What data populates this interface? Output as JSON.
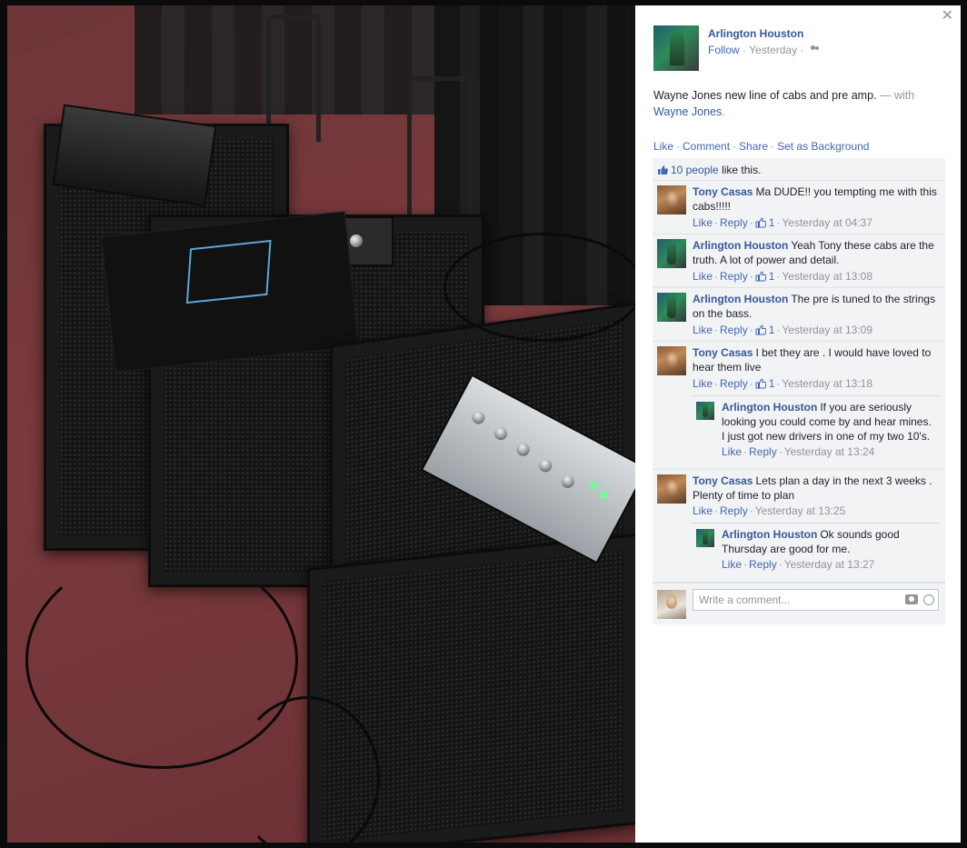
{
  "post": {
    "author": "Arlington Houston",
    "follow": "Follow",
    "sep": "·",
    "time": "Yesterday",
    "caption": "Wayne Jones new line of cabs and pre amp.",
    "with_prefix": "— with",
    "tagged": "Wayne Jones",
    "tagged_suffix": "."
  },
  "actions": {
    "like": "Like",
    "comment": "Comment",
    "share": "Share",
    "set_background": "Set as Background"
  },
  "likes": {
    "count_link": "10 people",
    "suffix": "like this."
  },
  "comments": [
    {
      "name": "Tony Casas",
      "text": "Ma DUDE!! you tempting me with this cabs!!!!!",
      "like": "Like",
      "reply": "Reply",
      "likes": "1",
      "time": "Yesterday at 04:37"
    },
    {
      "name": "Arlington Houston",
      "text": "Yeah Tony these cabs are the truth. A lot of power and detail.",
      "like": "Like",
      "reply": "Reply",
      "likes": "1",
      "time": "Yesterday at 13:08"
    },
    {
      "name": "Arlington Houston",
      "text": "The pre is tuned to the strings on the bass.",
      "like": "Like",
      "reply": "Reply",
      "likes": "1",
      "time": "Yesterday at 13:09"
    },
    {
      "name": "Tony Casas",
      "text": "I bet they are . I would have loved to hear them live",
      "like": "Like",
      "reply": "Reply",
      "likes": "1",
      "time": "Yesterday at 13:18",
      "reply_item": {
        "name": "Arlington Houston",
        "text": "If you are seriously looking you could come by and hear mines. I just got new drivers in one of my two 10's.",
        "like": "Like",
        "reply": "Reply",
        "time": "Yesterday at 13:24"
      }
    },
    {
      "name": "Tony Casas",
      "text": "Lets plan a day in the next 3 weeks . Plenty of time to plan",
      "like": "Like",
      "reply": "Reply",
      "time": "Yesterday at 13:25",
      "reply_item": {
        "name": "Arlington Houston",
        "text": "Ok sounds good Thursday are good for me.",
        "like": "Like",
        "reply": "Reply",
        "time": "Yesterday at 13:27"
      }
    }
  ],
  "composer": {
    "placeholder": "Write a comment..."
  },
  "colors": {
    "link": "#365899",
    "feedback_bg": "#f2f3f5",
    "meta": "#90949c"
  },
  "icons": [
    "close-icon",
    "friends-icon",
    "like-thumb-icon",
    "camera-icon",
    "emoji-icon"
  ]
}
